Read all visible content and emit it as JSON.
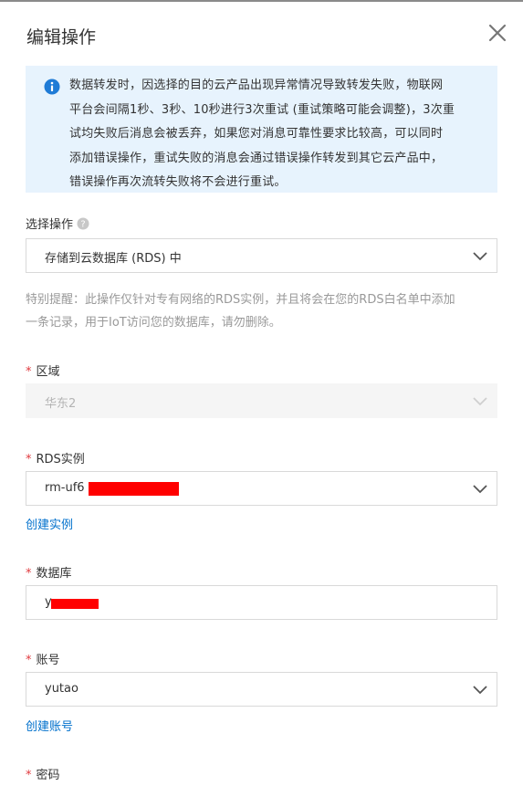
{
  "dialog": {
    "title": "编辑操作",
    "close_icon": "close-icon"
  },
  "notice": {
    "icon": "info-icon",
    "color": "#e7f3fd",
    "lines": [
      "数据转发时，因选择的目的云产品出现异常情况导致转发失败，物联网",
      "平台会间隔1秒、3秒、10秒进行3次重试 (重试策略可能会调整)，3次重",
      "试均失败后消息会被丢弃，如果您对消息可靠性要求比较高，可以同时",
      "添加错误操作，重试失败的消息会通过错误操作转发到其它云产品中，",
      "错误操作再次流转失败将不会进行重试。"
    ]
  },
  "operation": {
    "label": "选择操作",
    "help_icon": "question-icon",
    "value": "存储到云数据库 (RDS) 中"
  },
  "hint": {
    "lines": [
      "特别提醒：此操作仅针对专有网络的RDS实例，并且将会在您的RDS白名单中添加",
      "一条记录，用于IoT访问您的数据库，请勿删除。"
    ]
  },
  "region": {
    "required_mark": "*",
    "label": "区域",
    "value": "华东2"
  },
  "rds_instance": {
    "required_mark": "*",
    "label": "RDS实例",
    "value": "rm-uf6",
    "create_link": "创建实例"
  },
  "database": {
    "required_mark": "*",
    "label": "数据库",
    "value": "y"
  },
  "account": {
    "required_mark": "*",
    "label": "账号",
    "value": "yutao",
    "create_link": "创建账号"
  },
  "password": {
    "required_mark": "*",
    "label": "密码"
  },
  "colors": {
    "required": "#e0393e",
    "link": "#0070cc",
    "info_icon": "#1f7bd6",
    "redaction": "#ff0000"
  }
}
